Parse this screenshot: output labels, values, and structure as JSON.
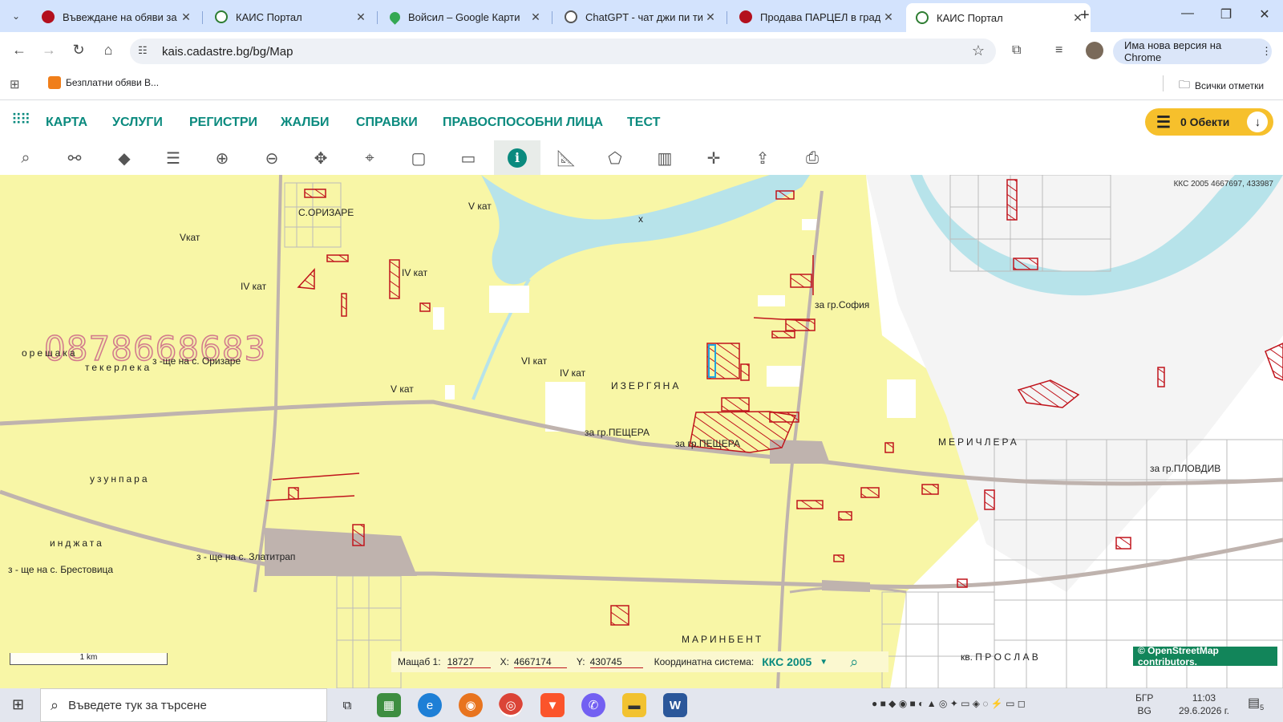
{
  "browser": {
    "tabs": [
      {
        "title": "Въвеждане на обяви за П",
        "favicon_color": "#b3101e",
        "active": false
      },
      {
        "title": "КАИС Портал",
        "favicon_color": "#2e7d32",
        "active": false
      },
      {
        "title": "Войсил – Google Карти",
        "favicon_color": "#34a853",
        "active": false
      },
      {
        "title": "ChatGPT - чат джи пи ти",
        "favicon_color": "#555555",
        "active": false
      },
      {
        "title": "Продава ПАРЦЕЛ в град",
        "favicon_color": "#b3101e",
        "active": false
      },
      {
        "title": "КАИС Портал",
        "favicon_color": "#2e7d32",
        "active": true
      }
    ],
    "url": "kais.cadastre.bg/bg/Map",
    "update_label": "Има нова версия на Chrome",
    "bookmark": "Безплатни обяви В...",
    "all_bookmarks": "Всички отметки"
  },
  "app": {
    "menu": [
      "КАРТА",
      "УСЛУГИ",
      "РЕГИСТРИ",
      "ЖАЛБИ",
      "СПРАВКИ",
      "ПРАВОСПОСОБНИ ЛИЦА",
      "ТЕСТ"
    ],
    "objects_label": "0 Обекти",
    "accent": "#0a8a7e"
  },
  "map": {
    "top_coords": "ККС 2005 4667697, 433987",
    "phone": "0878668683",
    "labels": {
      "orizare": "С.ОРИЗАРЕ",
      "v_kat_1": "V кат",
      "x": "x",
      "vkat2": "Vкат",
      "iv_kat_1": "IV кат",
      "iv_kat_2": "IV кат",
      "za_sofia": "за гр.София",
      "oreshaka": "орешака",
      "teklerka": "текерлека",
      "z_orizare": "з -ще на с. Оризаре",
      "vi_kat": "VI кат",
      "iv_kat_3": "IV кат",
      "izergyana": "ИЗЕРГЯНА",
      "v_kat_3": "V кат",
      "peshtera_1": "за гр.ПЕЩЕРА",
      "peshtera_2": "за гр.ПЕЩЕРА",
      "merichlerа": "МЕРИЧЛЕРА",
      "plovdiv": "за гр.ПЛОВДИВ",
      "uzunpara": "узунпара",
      "indzhata": "инджата",
      "zlatitrap": "з - ще на с. Златитрап",
      "brestovitsa": "з - ще на с. Брестовица",
      "marinbent": "МАРИНБЕНТ",
      "proslav": "кв. П Р О С Л А В"
    },
    "scale_bar": "1 km",
    "status": {
      "scale_label": "Мащаб 1:",
      "scale_value": "18727",
      "x_label": "X:",
      "x_value": "4667174",
      "y_label": "Y:",
      "y_value": "430745",
      "crs_label": "Координатна система:",
      "crs_value": "ККС 2005"
    },
    "attribution": "© OpenStreetMap contributors.",
    "colors": {
      "land": "#f8f6a6",
      "water": "#b7e3ea",
      "parcel": "#c0141c",
      "road": "#bfb3ae"
    }
  },
  "taskbar": {
    "search_placeholder": "Въведете тук за търсене",
    "lang_top": "БГР",
    "lang_bottom": "BG",
    "time": "11:03",
    "date": "29.6.2026 г.",
    "notif": "5"
  }
}
